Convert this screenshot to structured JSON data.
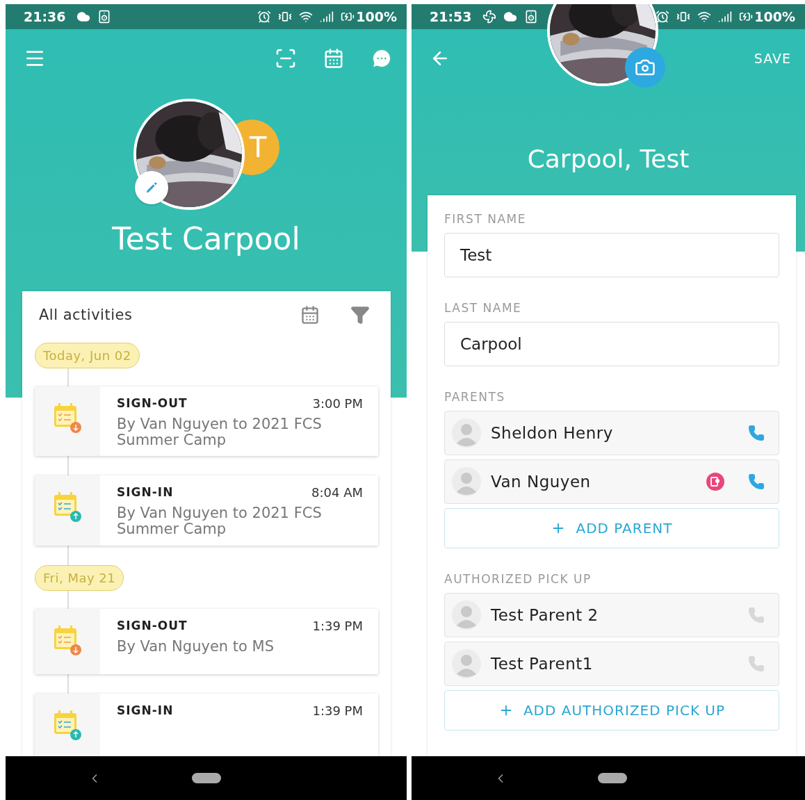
{
  "screens": [
    {
      "status_bar": {
        "time": "21:36",
        "battery": "100%"
      },
      "profile": {
        "initials": "T",
        "name": "Test Carpool"
      },
      "activities": {
        "title": "All activities",
        "groups": [
          {
            "date": "Today, Jun 02",
            "items": [
              {
                "kind": "sign-out",
                "title": "SIGN-OUT",
                "time": "3:00 PM",
                "description": "By Van Nguyen to 2021 FCS Summer Camp"
              },
              {
                "kind": "sign-in",
                "title": "SIGN-IN",
                "time": "8:04 AM",
                "description": "By Van Nguyen to 2021 FCS Summer Camp"
              }
            ]
          },
          {
            "date": "Fri, May 21",
            "items": [
              {
                "kind": "sign-out",
                "title": "SIGN-OUT",
                "time": "1:39 PM",
                "description": "By Van Nguyen to MS"
              },
              {
                "kind": "sign-in",
                "title": "SIGN-IN",
                "time": "1:39 PM"
              }
            ]
          }
        ]
      }
    },
    {
      "status_bar": {
        "time": "21:53",
        "battery": "100%"
      },
      "toolbar": {
        "save": "SAVE"
      },
      "title": "Carpool, Test",
      "fields": [
        {
          "label": "FIRST NAME",
          "value": "Test"
        },
        {
          "label": "LAST NAME",
          "value": "Carpool"
        }
      ],
      "sections": [
        {
          "label": "PARENTS",
          "people": [
            {
              "name": "Sheldon Henry",
              "app_user": false,
              "phone_active": true
            },
            {
              "name": "Van Nguyen",
              "app_user": true,
              "phone_active": true
            }
          ],
          "add_button": "ADD PARENT"
        },
        {
          "label": "AUTHORIZED PICK UP",
          "people": [
            {
              "name": "Test Parent 2",
              "app_user": false,
              "phone_active": false
            },
            {
              "name": "Test Parent1",
              "app_user": false,
              "phone_active": false
            }
          ],
          "add_button": "ADD AUTHORIZED PICK UP"
        }
      ]
    }
  ]
}
